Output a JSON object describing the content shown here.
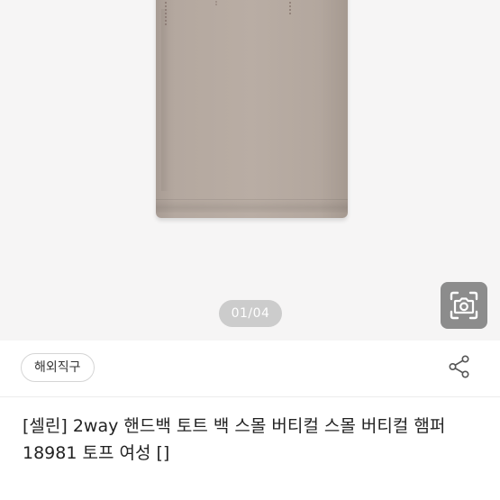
{
  "gallery": {
    "counter": "01/04"
  },
  "tag": {
    "label": "해외직구"
  },
  "product": {
    "title": "[셀린] 2way 핸드백 토트 백 스몰 버티컬 스몰 버티컬 햄퍼 18981 토프 여성 []"
  },
  "icons": {
    "camera": "camera-icon",
    "share": "share-icon"
  },
  "colors": {
    "image_bg": "#f6f5f5",
    "bag": "#b5a9a0",
    "camera_button": "#8c8c8c"
  }
}
